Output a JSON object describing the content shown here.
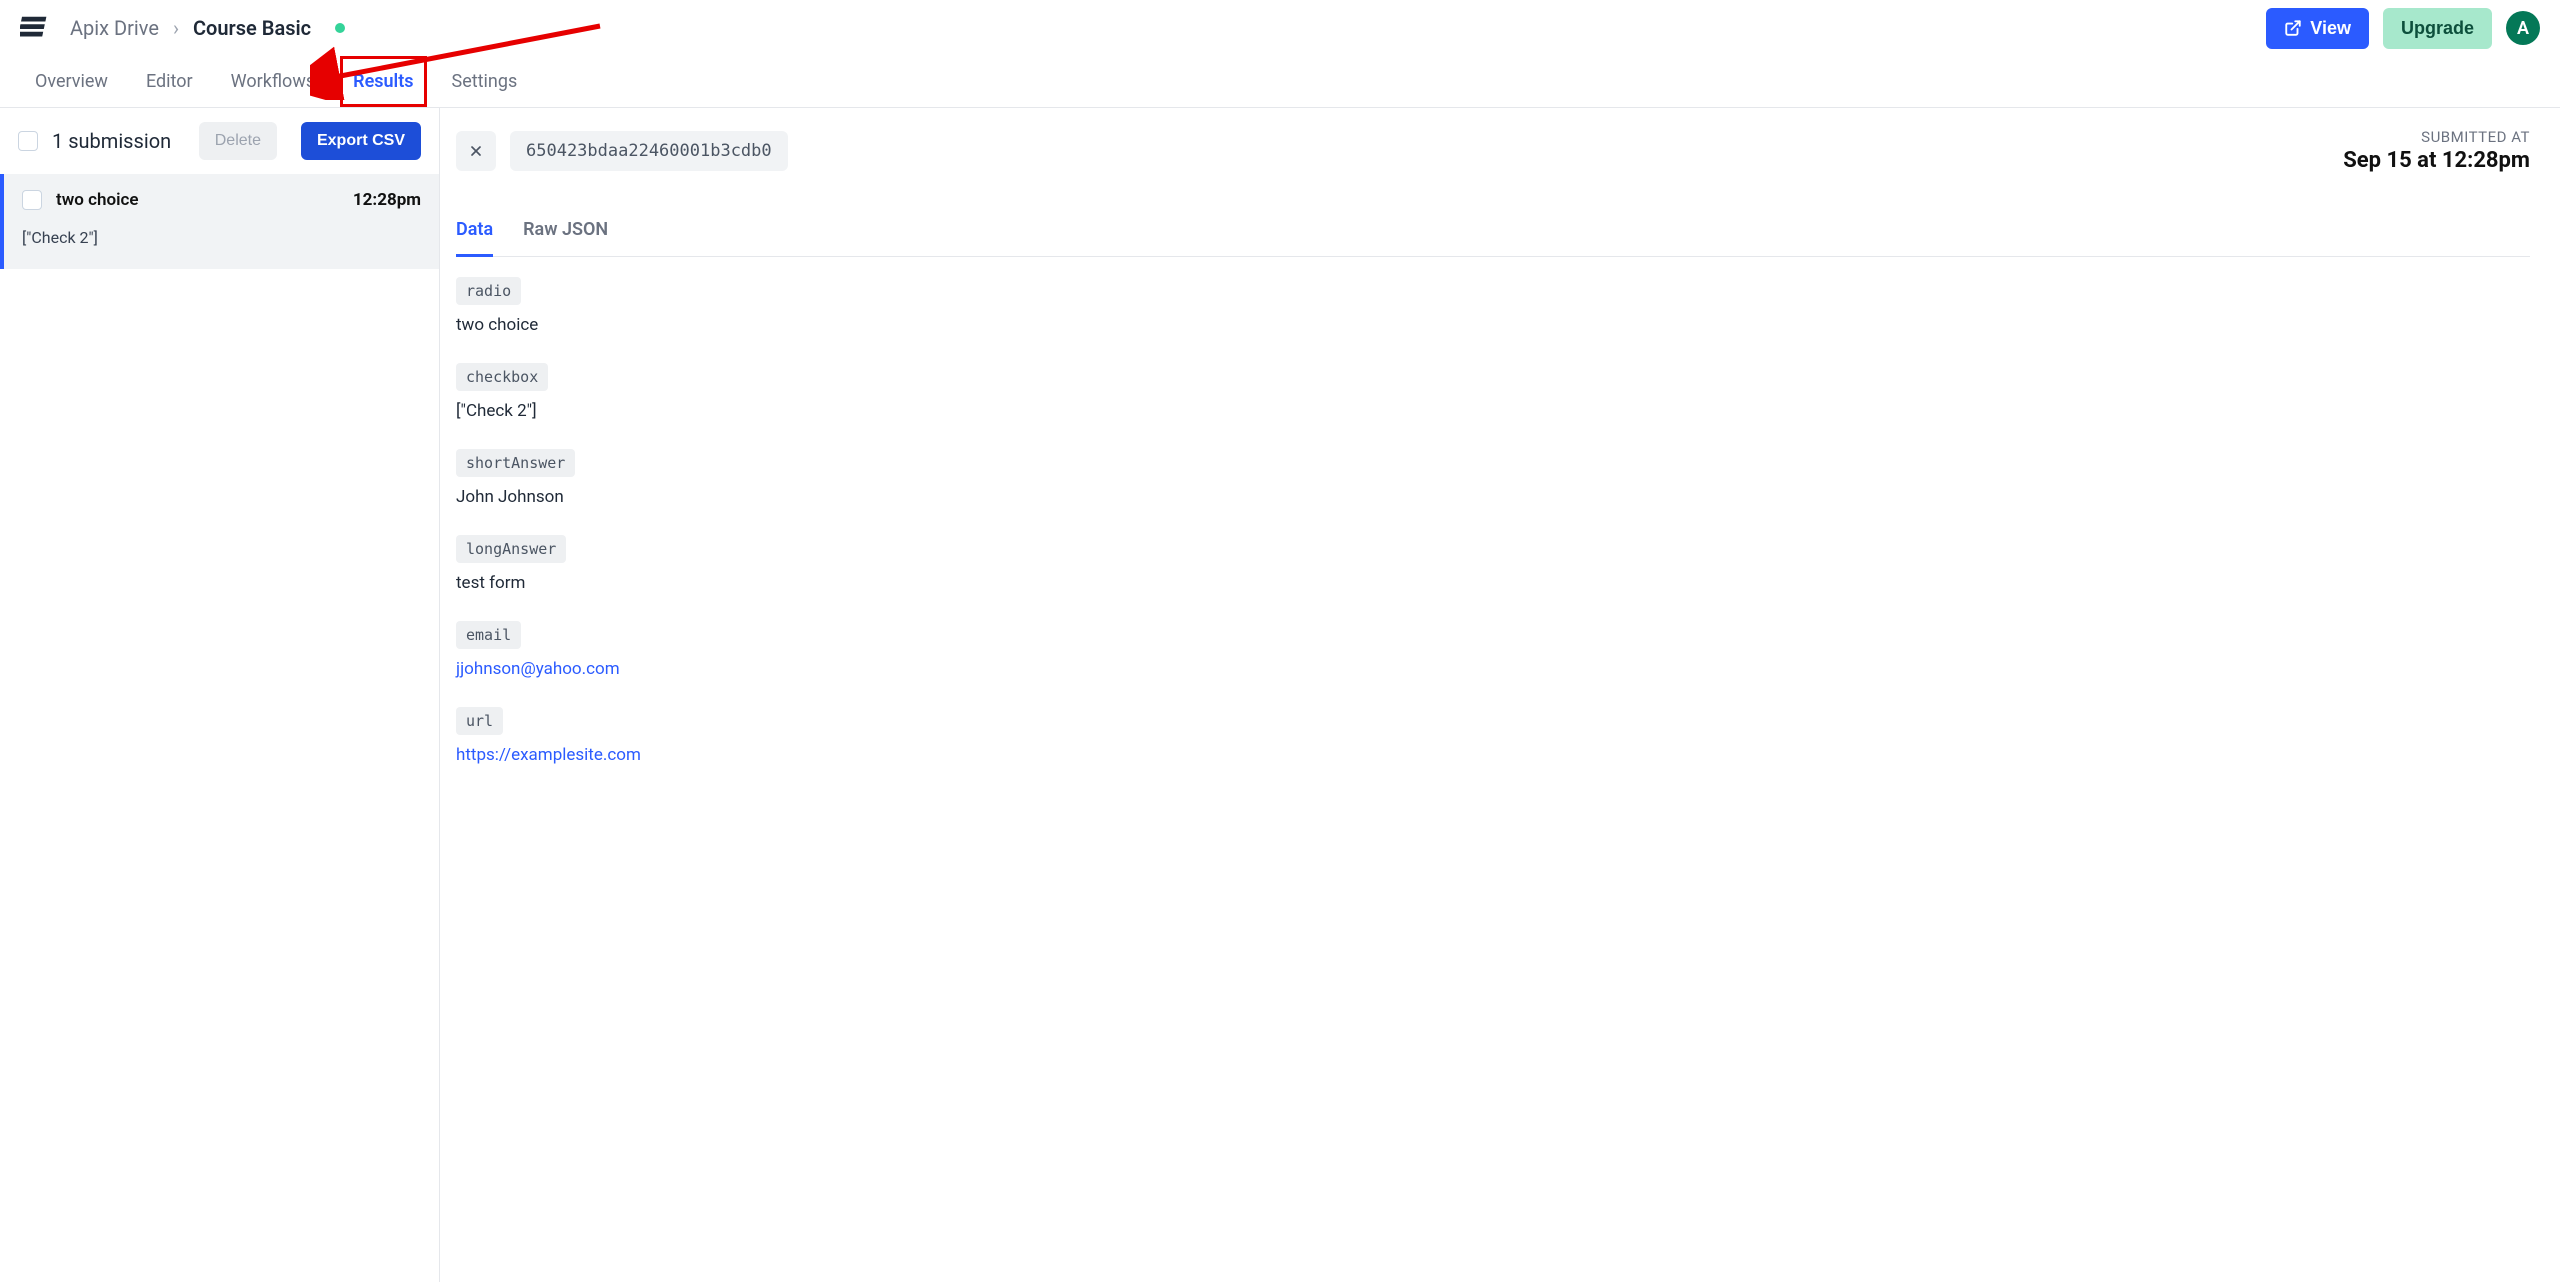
{
  "header": {
    "breadcrumb_root": "Apix Drive",
    "breadcrumb_current": "Course Basic",
    "view_label": "View",
    "upgrade_label": "Upgrade",
    "avatar_letter": "A"
  },
  "tabs": {
    "overview": "Overview",
    "editor": "Editor",
    "workflows": "Workflows",
    "results": "Results",
    "settings": "Settings"
  },
  "list": {
    "count_label": "1 submission",
    "delete_label": "Delete",
    "export_label": "Export CSV",
    "items": [
      {
        "title": "two choice",
        "time": "12:28pm",
        "preview": "[\"Check 2\"]"
      }
    ]
  },
  "detail": {
    "id": "650423bdaa22460001b3cdb0",
    "submitted_label": "SUBMITTED AT",
    "submitted_time": "Sep 15 at 12:28pm",
    "tabs": {
      "data": "Data",
      "raw": "Raw JSON"
    },
    "fields": [
      {
        "key": "radio",
        "value": "two choice",
        "link": false
      },
      {
        "key": "checkbox",
        "value": "[\"Check 2\"]",
        "link": false
      },
      {
        "key": "shortAnswer",
        "value": "John Johnson",
        "link": false
      },
      {
        "key": "longAnswer",
        "value": "test form",
        "link": false
      },
      {
        "key": "email",
        "value": "jjohnson@yahoo.com",
        "link": true
      },
      {
        "key": "url",
        "value": "https://examplesite.com",
        "link": true
      }
    ]
  }
}
